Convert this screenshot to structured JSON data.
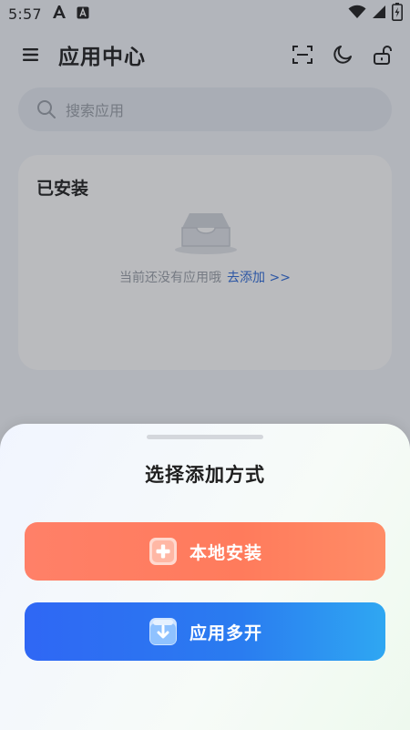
{
  "status_bar": {
    "time": "5:57"
  },
  "app_bar": {
    "title": "应用中心"
  },
  "search": {
    "placeholder": "搜索应用"
  },
  "installed": {
    "title": "已安装",
    "empty_text": "当前还没有应用哦",
    "add_link": "去添加 >>"
  },
  "sheet": {
    "title": "选择添加方式",
    "options": [
      {
        "label": "本地安装",
        "icon": "plus-box-icon"
      },
      {
        "label": "应用多开",
        "icon": "download-box-icon"
      }
    ]
  },
  "colors": {
    "accent_orange": "#ff7b5c",
    "accent_blue": "#2a6ff2",
    "link_blue": "#2e6bd9"
  }
}
